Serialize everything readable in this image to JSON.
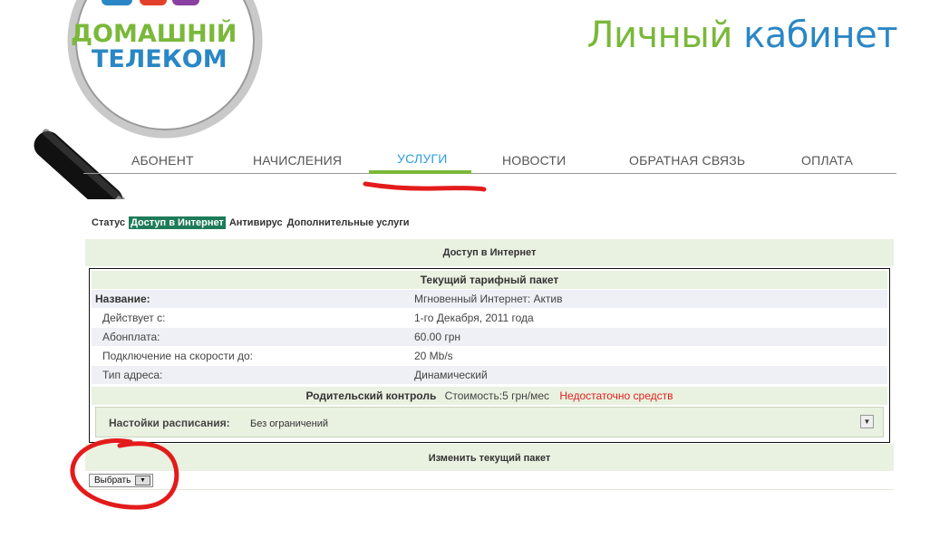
{
  "brand": {
    "logo_line1": "ДОМАШНІЙ",
    "logo_line2": "ТЕЛЕКОМ",
    "title_word1": "Личный",
    "title_word2": "кабинет",
    "colors": {
      "green": "#7ab83a",
      "blue": "#2a87c5"
    }
  },
  "main_nav": {
    "items": [
      {
        "label": "АБОНЕНТ"
      },
      {
        "label": "НАЧИСЛЕНИЯ"
      },
      {
        "label": "УСЛУГИ",
        "active": true
      },
      {
        "label": "НОВОСТИ"
      },
      {
        "label": "ОБРАТНАЯ СВЯЗЬ"
      },
      {
        "label": "ОПЛАТА"
      }
    ]
  },
  "sub_nav": {
    "items": [
      {
        "label": "Статус"
      },
      {
        "label": "Доступ в Интернет",
        "selected": true
      },
      {
        "label": "Антивирус"
      },
      {
        "label": "Дополнительные услуги"
      }
    ]
  },
  "internet": {
    "section_title": "Доступ в Интернет",
    "tariff_header": "Текущий тарифный пакет",
    "rows": [
      {
        "label": "Название:",
        "value": "Мгновенный Интернет: Актив"
      },
      {
        "label": "Действует с:",
        "value": "1-го Декабря, 2011 года"
      },
      {
        "label": "Абонплата:",
        "value": "60.00 грн"
      },
      {
        "label": "Подключение на скорости до:",
        "value": "20 Mb/s"
      },
      {
        "label": "Тип адреса:",
        "value": "Динамический"
      }
    ],
    "parental_control": {
      "title": "Родительский контроль",
      "cost": "Стоимость:5 грн/мес",
      "warning": "Недостаточно средств"
    },
    "schedule": {
      "label": "Настойки расписания:",
      "value": "Без ограничений"
    },
    "change_title": "Изменить текущий пакет",
    "select_label": "Выбрать"
  }
}
